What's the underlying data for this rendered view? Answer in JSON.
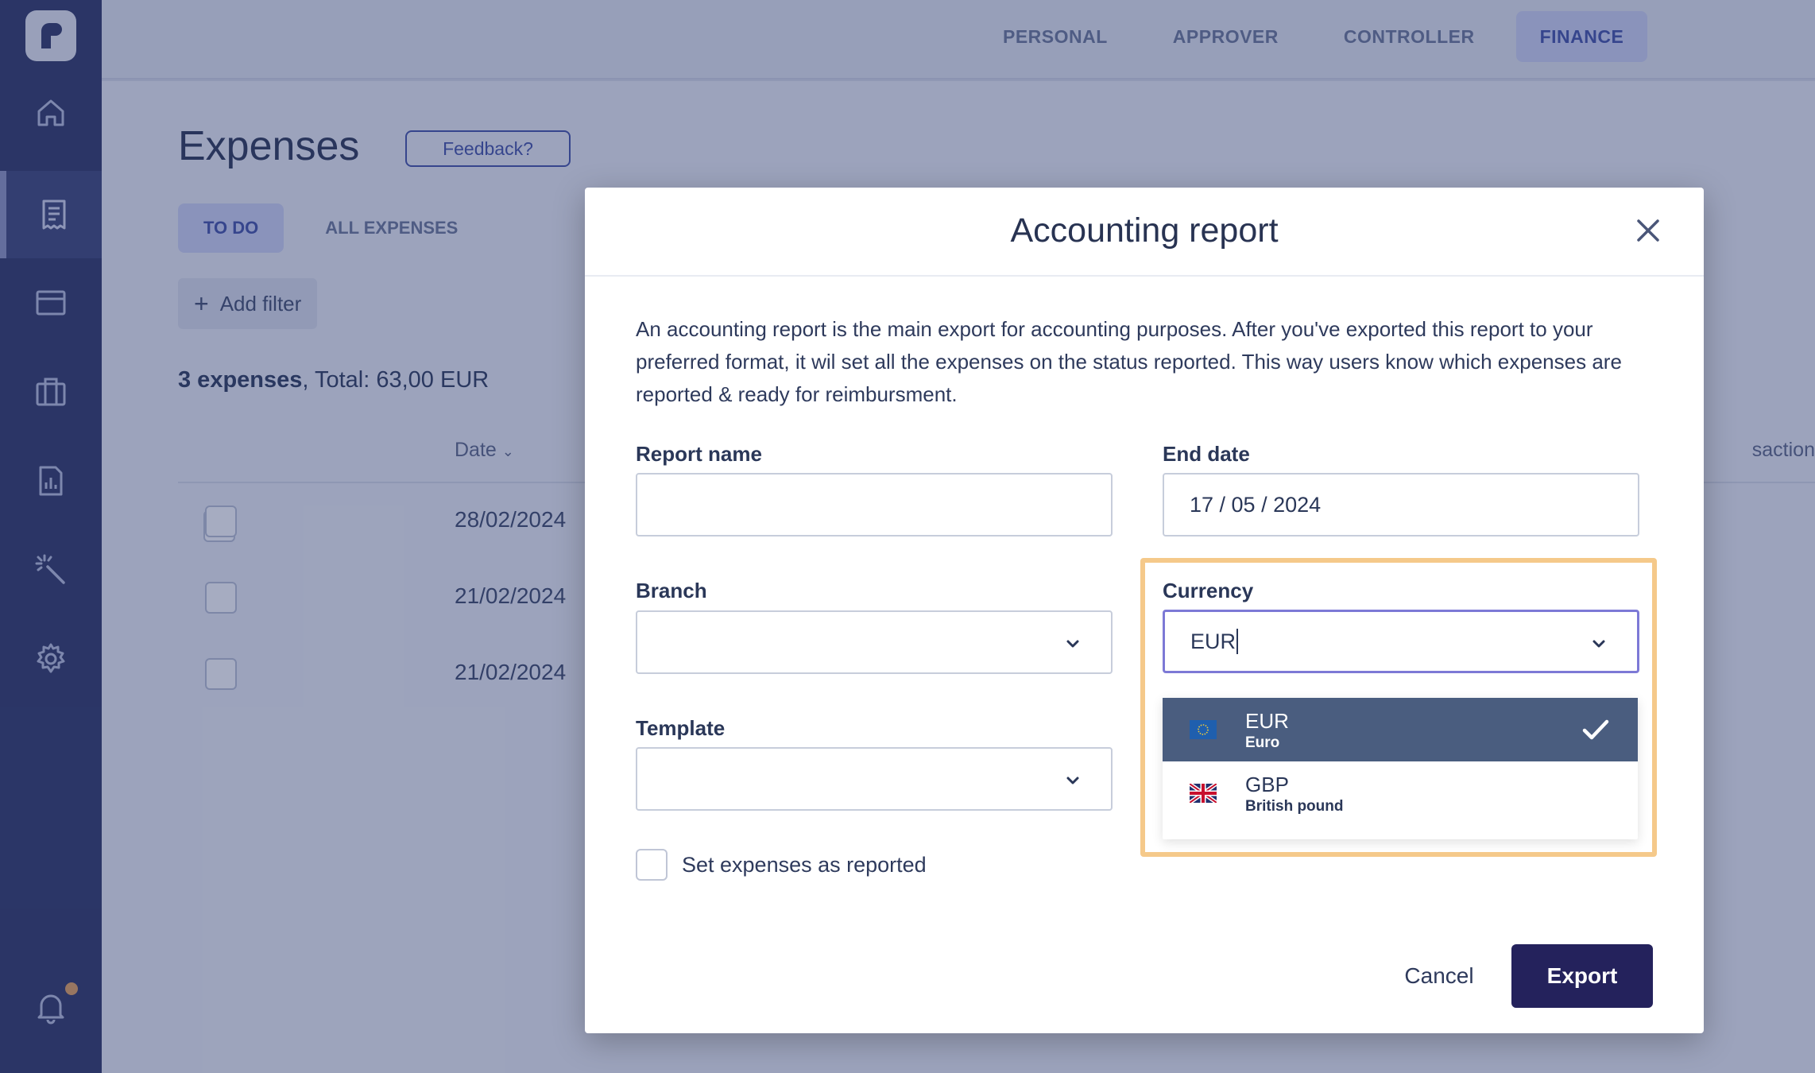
{
  "role_tabs": [
    {
      "label": "PERSONAL"
    },
    {
      "label": "APPROVER"
    },
    {
      "label": "CONTROLLER"
    },
    {
      "label": "FINANCE"
    }
  ],
  "page": {
    "title": "Expenses",
    "feedback_label": "Feedback?",
    "tabs": [
      {
        "label": "TO DO"
      },
      {
        "label": "ALL EXPENSES"
      }
    ],
    "add_filter_label": "Add filter",
    "summary_count": "3 expenses",
    "summary_total": ", Total: 63,00 EUR",
    "columns": {
      "date": "Date",
      "transaction": "saction"
    },
    "rows": [
      {
        "date": "28/02/2024"
      },
      {
        "date": "21/02/2024"
      },
      {
        "date": "21/02/2024"
      }
    ]
  },
  "modal": {
    "title": "Accounting report",
    "description": "An accounting report is the main export for accounting purposes. After you've exported this report to your preferred format, it wil set all the expenses on the status reported. This way users know which expenses are reported & ready for reimbursment.",
    "report_name": {
      "label": "Report name",
      "value": ""
    },
    "end_date": {
      "label": "End date",
      "value": "17 / 05 / 2024"
    },
    "branch": {
      "label": "Branch",
      "value": ""
    },
    "currency": {
      "label": "Currency",
      "value": "EUR"
    },
    "template": {
      "label": "Template",
      "value": ""
    },
    "currency_options": [
      {
        "code": "EUR",
        "name": "Euro",
        "flag": "eu-flag-icon",
        "selected": true
      },
      {
        "code": "GBP",
        "name": "British pound",
        "flag": "uk-flag-icon",
        "selected": false
      }
    ],
    "set_reported_label": "Set expenses as reported",
    "cancel_label": "Cancel",
    "export_label": "Export"
  },
  "colors": {
    "sidebar": "#2b3363",
    "accent": "#3e4ea6",
    "primary_button": "#24225c",
    "selected_option": "#4a5d7f",
    "highlight": "#f5c98a"
  }
}
